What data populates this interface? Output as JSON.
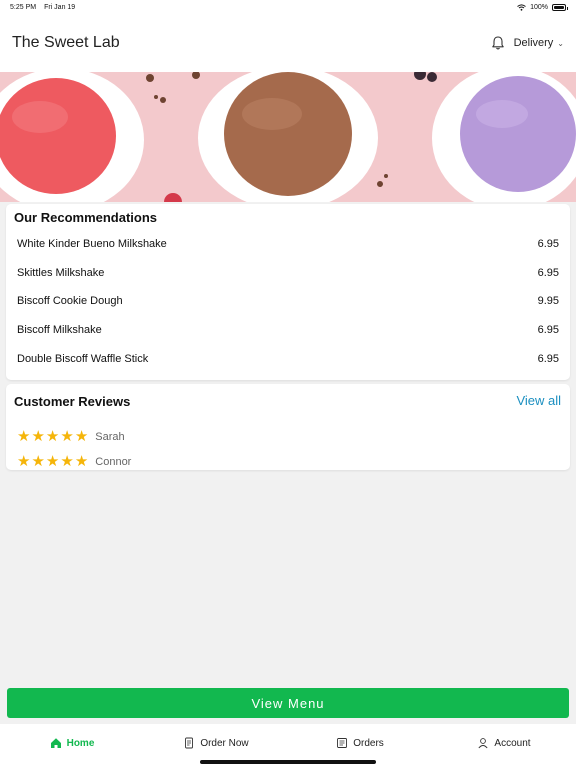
{
  "status_bar": {
    "time": "5:25 PM",
    "date": "Fri Jan 19",
    "battery": "100%",
    "battery_level": 1.0
  },
  "header": {
    "title": "The Sweet Lab",
    "notification_icon": "bell-icon",
    "delivery_label": "Delivery",
    "delivery_icon": "chevron-down-icon"
  },
  "hero": {
    "image": "ice-cream-scoops-banner",
    "colors": {
      "background": "#f3c9cc",
      "strawberry": "#ee5a60",
      "chocolate": "#a56a4c",
      "berry": "#b69ad9"
    }
  },
  "recommendations": {
    "title": "Our Recommendations",
    "items": [
      {
        "name": "White Kinder Bueno Milkshake",
        "price": "6.95"
      },
      {
        "name": "Skittles Milkshake",
        "price": "6.95"
      },
      {
        "name": "Biscoff Cookie Dough",
        "price": "9.95"
      },
      {
        "name": "Biscoff Milkshake",
        "price": "6.95"
      },
      {
        "name": "Double Biscoff Waffle Stick",
        "price": "6.95"
      }
    ]
  },
  "reviews": {
    "title": "Customer Reviews",
    "view_all": "View all",
    "items": [
      {
        "name": "Sarah",
        "rating": 5
      },
      {
        "name": "Connor",
        "rating": 5
      }
    ]
  },
  "view_menu": {
    "label": "View Menu"
  },
  "tabs": [
    {
      "label": "Home",
      "icon": "home-icon",
      "active": true
    },
    {
      "label": "Order Now",
      "icon": "order-icon",
      "active": false
    },
    {
      "label": "Orders",
      "icon": "receipt-icon",
      "active": false
    },
    {
      "label": "Account",
      "icon": "user-icon",
      "active": false
    }
  ],
  "colors": {
    "accent": "#12b84f",
    "link": "#1b8fc0",
    "star": "#f5b50a",
    "background": "#f1f1f1"
  }
}
